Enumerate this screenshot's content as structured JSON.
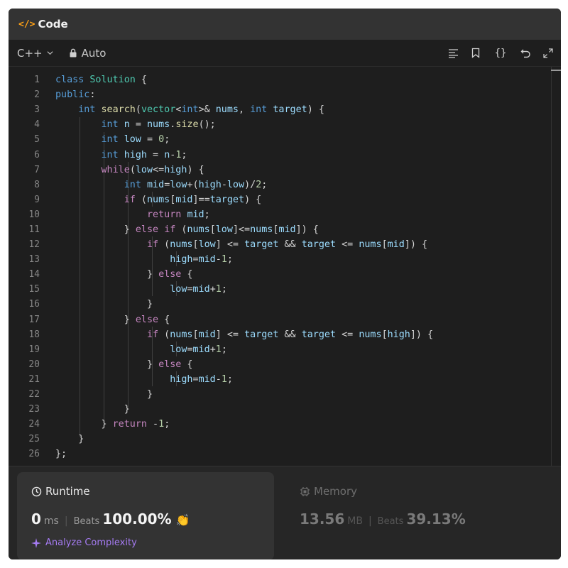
{
  "header": {
    "icon": "code-brackets-icon",
    "title": "Code"
  },
  "toolbar": {
    "language": "C++",
    "mode": "Auto",
    "icons": [
      "format-icon",
      "bookmark-icon",
      "braces-icon",
      "undo-icon",
      "expand-icon"
    ]
  },
  "editor": {
    "line_numbers": [
      "1",
      "2",
      "3",
      "4",
      "5",
      "6",
      "7",
      "8",
      "9",
      "10",
      "11",
      "12",
      "13",
      "14",
      "15",
      "16",
      "17",
      "18",
      "19",
      "20",
      "21",
      "22",
      "23",
      "24",
      "25",
      "26"
    ],
    "lines": [
      "class Solution {",
      "public:",
      "    int search(vector<int>& nums, int target) {",
      "        int n = nums.size();",
      "        int low = 0;",
      "        int high = n-1;",
      "        while(low<=high) {",
      "            int mid=low+(high-low)/2;",
      "            if (nums[mid]==target) {",
      "                return mid;",
      "            } else if (nums[low]<=nums[mid]) {",
      "                if (nums[low] <= target && target <= nums[mid]) {",
      "                    high=mid-1;",
      "                } else {",
      "                    low=mid+1;",
      "                }",
      "            } else {",
      "                if (nums[mid] <= target && target <= nums[high]) {",
      "                    low=mid+1;",
      "                } else {",
      "                    high=mid-1;",
      "                }",
      "            }",
      "        } return -1;",
      "    }",
      "};"
    ]
  },
  "runtime": {
    "title": "Runtime",
    "value": "0",
    "unit": "ms",
    "beats_label": "Beats",
    "beats_value": "100.00%",
    "analyze_label": "Analyze Complexity"
  },
  "memory": {
    "title": "Memory",
    "value": "13.56",
    "unit": "MB",
    "beats_label": "Beats",
    "beats_value": "39.13%"
  },
  "colors": {
    "accent": "#ffa116",
    "analyze": "#a57bf2",
    "keyword": "#569cd6",
    "number": "#b5cea8"
  }
}
